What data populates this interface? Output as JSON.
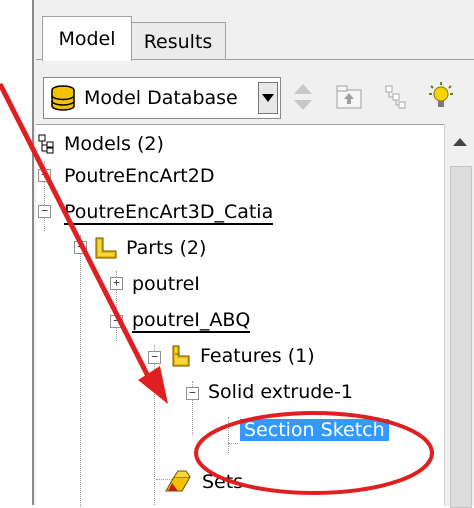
{
  "tabs": {
    "model": "Model",
    "results": "Results"
  },
  "toolbar": {
    "combo_value": "Model Database",
    "icons": [
      "database-icon",
      "dropdown-arrow-icon",
      "up-down-arrows-icon",
      "tree-up-icon",
      "tree-filter-icon",
      "lightbulb-icon"
    ]
  },
  "tree": {
    "models": "Models (2)",
    "model1": "PoutreEncArt2D",
    "model2": "PoutreEncArt3D_Catia",
    "parts": "Parts (2)",
    "part1": "poutreI",
    "part2": "poutreI_ABQ",
    "features": "Features (1)",
    "feature1": "Solid extrude-1",
    "sketch": "Section Sketch",
    "sets": "Sets"
  },
  "colors": {
    "selection": "#3399ff",
    "annotation": "#e02020"
  }
}
